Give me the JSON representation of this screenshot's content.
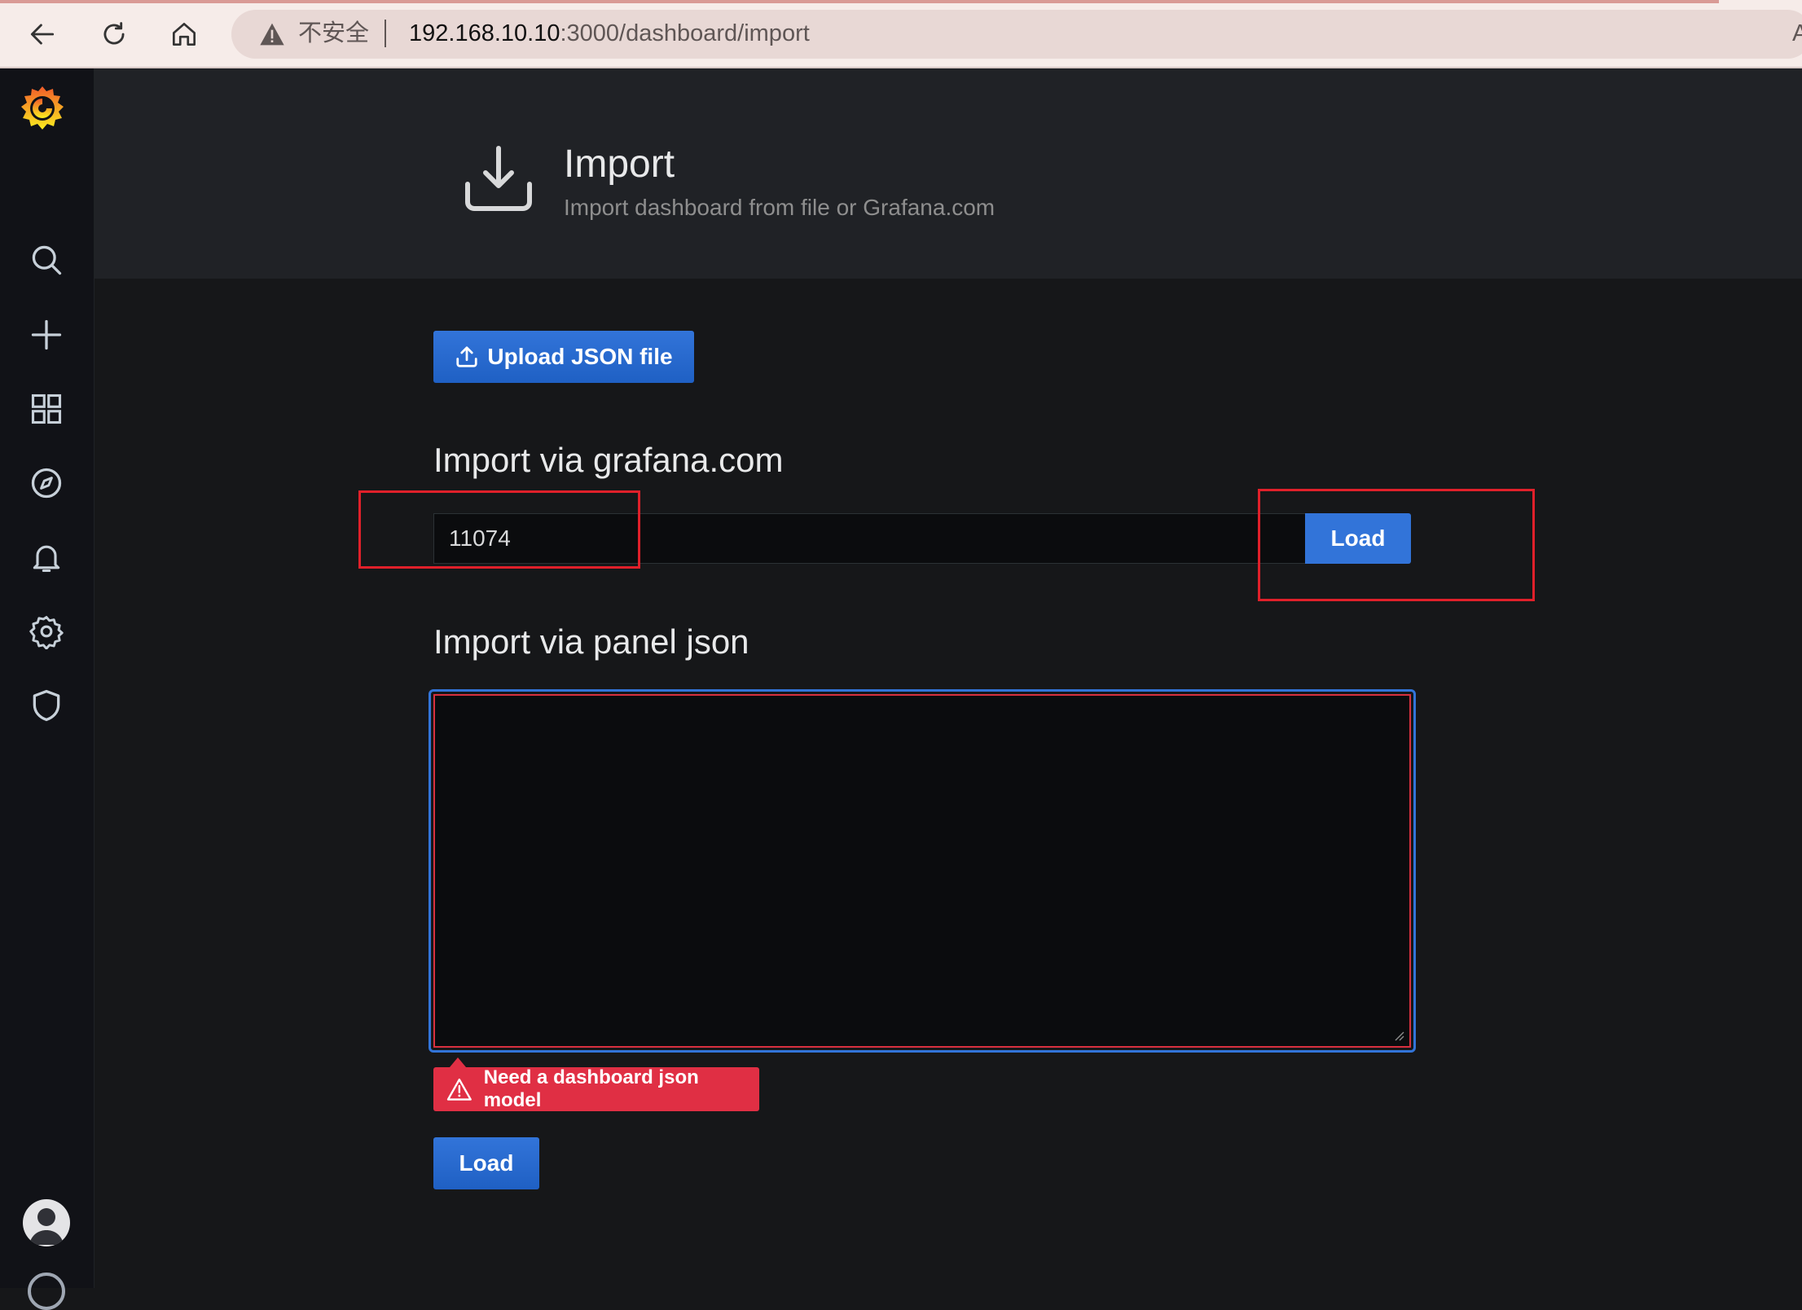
{
  "browser": {
    "insecure_label": "不安全",
    "url_host": "192.168.10.10",
    "url_path": ":3000/dashboard/import",
    "extra_label": "A"
  },
  "sidebar": {
    "items": [
      {
        "icon": "search-icon"
      },
      {
        "icon": "plus-icon"
      },
      {
        "icon": "dashboards-icon"
      },
      {
        "icon": "compass-icon"
      },
      {
        "icon": "bell-icon"
      },
      {
        "icon": "gear-icon"
      },
      {
        "icon": "shield-icon"
      }
    ]
  },
  "header": {
    "title": "Import",
    "subtitle": "Import dashboard from file or Grafana.com"
  },
  "main": {
    "upload_label": "Upload JSON file",
    "gcom_title": "Import via grafana.com",
    "gcom_value": "11074",
    "gcom_load_label": "Load",
    "panel_json_title": "Import via panel json",
    "panel_json_value": "",
    "error_text": "Need a dashboard json model",
    "load_label": "Load"
  },
  "colors": {
    "primary": "#3274d9",
    "error": "#e02f44",
    "annotation": "#e0202a"
  }
}
